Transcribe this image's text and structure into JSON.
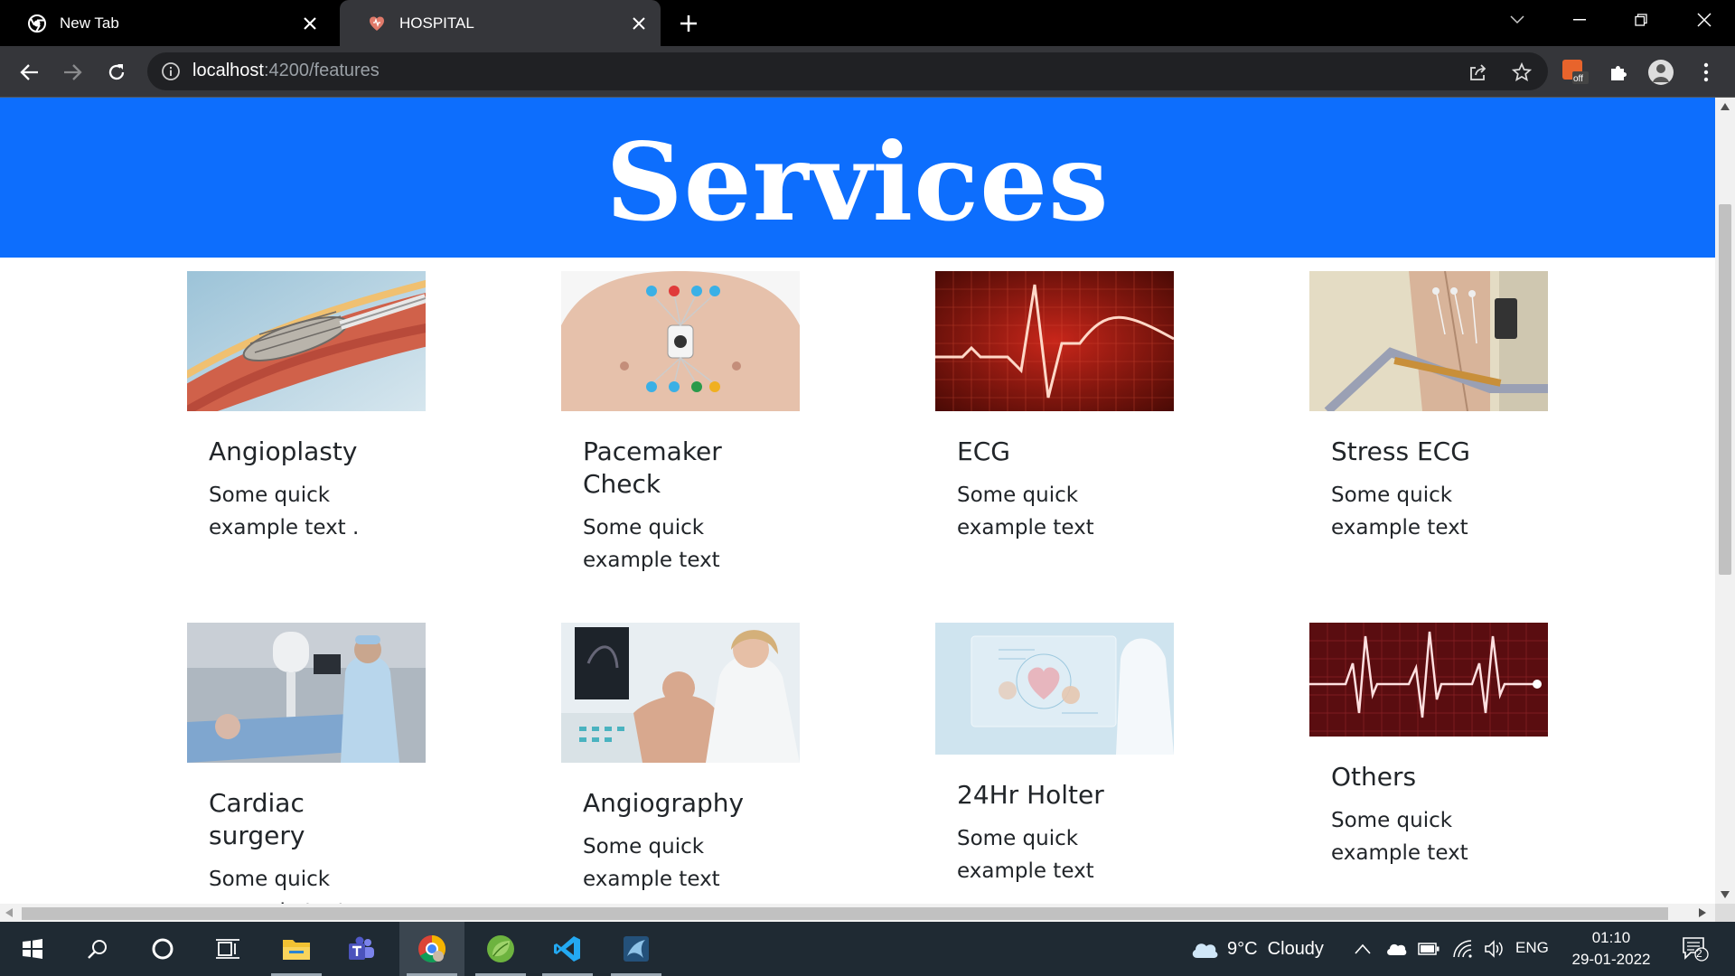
{
  "browser": {
    "tabs": [
      {
        "title": "New Tab"
      },
      {
        "title": "HOSPITAL"
      }
    ],
    "url_host": "localhost",
    "url_path": ":4200/features"
  },
  "page": {
    "heading": "Services",
    "cards": [
      {
        "title": "Angioplasty",
        "text": "Some quick example text .",
        "image": "stent-balloon-image"
      },
      {
        "title": "Pacemaker Check",
        "text": "Some quick example text",
        "image": "chest-electrodes-image"
      },
      {
        "title": "ECG",
        "text": "Some quick example text",
        "image": "ecg-waveform-image"
      },
      {
        "title": "Stress ECG",
        "text": "Some quick example text",
        "image": "treadmill-test-image"
      },
      {
        "title": "Cardiac surgery",
        "text": "Some quick example text .",
        "image": "operating-room-image"
      },
      {
        "title": "Angiography",
        "text": "Some quick example text",
        "image": "ultrasound-exam-image"
      },
      {
        "title": "24Hr Holter",
        "text": "Some quick example text",
        "image": "digital-heart-image"
      },
      {
        "title": "Others",
        "text": "Some quick example text",
        "image": "heartbeat-line-image"
      }
    ]
  },
  "taskbar": {
    "weather": "9°C  Cloudy",
    "language": "ENG",
    "time": "01:10",
    "date": "29-01-2022",
    "notifications": "2"
  },
  "colors": {
    "banner": "#0d6efd",
    "tabstrip": "#000000",
    "toolbar": "#35363a",
    "taskbar": "#1f2a33"
  }
}
